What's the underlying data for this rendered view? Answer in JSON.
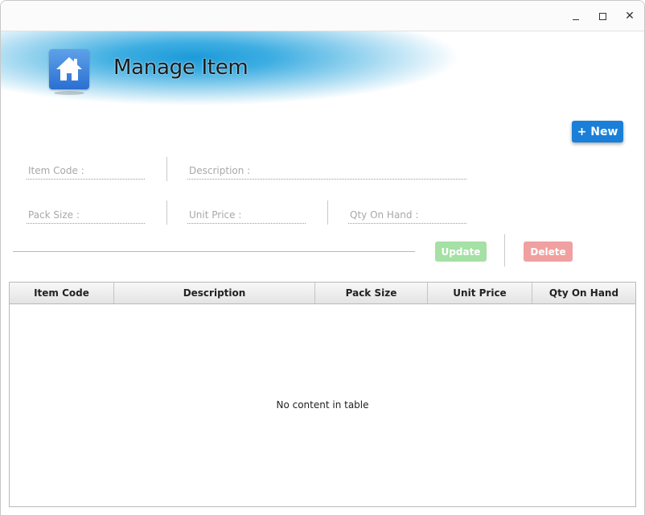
{
  "window": {
    "controls": [
      "minimize",
      "maximize",
      "close"
    ],
    "close_glyph": "✕"
  },
  "header": {
    "title": "Manage Item",
    "icon": "home-icon"
  },
  "toolbar": {
    "new_label": "+ New"
  },
  "form": {
    "item_code": {
      "placeholder": "Item Code :",
      "value": ""
    },
    "description": {
      "placeholder": "Description :",
      "value": ""
    },
    "pack_size": {
      "placeholder": "Pack Size :",
      "value": ""
    },
    "unit_price": {
      "placeholder": "Unit Price :",
      "value": ""
    },
    "qty_on_hand": {
      "placeholder": "Qty On Hand :",
      "value": ""
    },
    "update_label": "Update",
    "delete_label": "Delete"
  },
  "table": {
    "columns": [
      "Item Code",
      "Description",
      "Pack Size",
      "Unit Price",
      "Qty On Hand"
    ],
    "rows": [],
    "empty_message": "No content in table"
  },
  "colors": {
    "accent": "#1a7fd8",
    "update_disabled": "#a5e0a5",
    "delete_disabled": "#f0a0a0",
    "banner": "#1c9ad9"
  }
}
